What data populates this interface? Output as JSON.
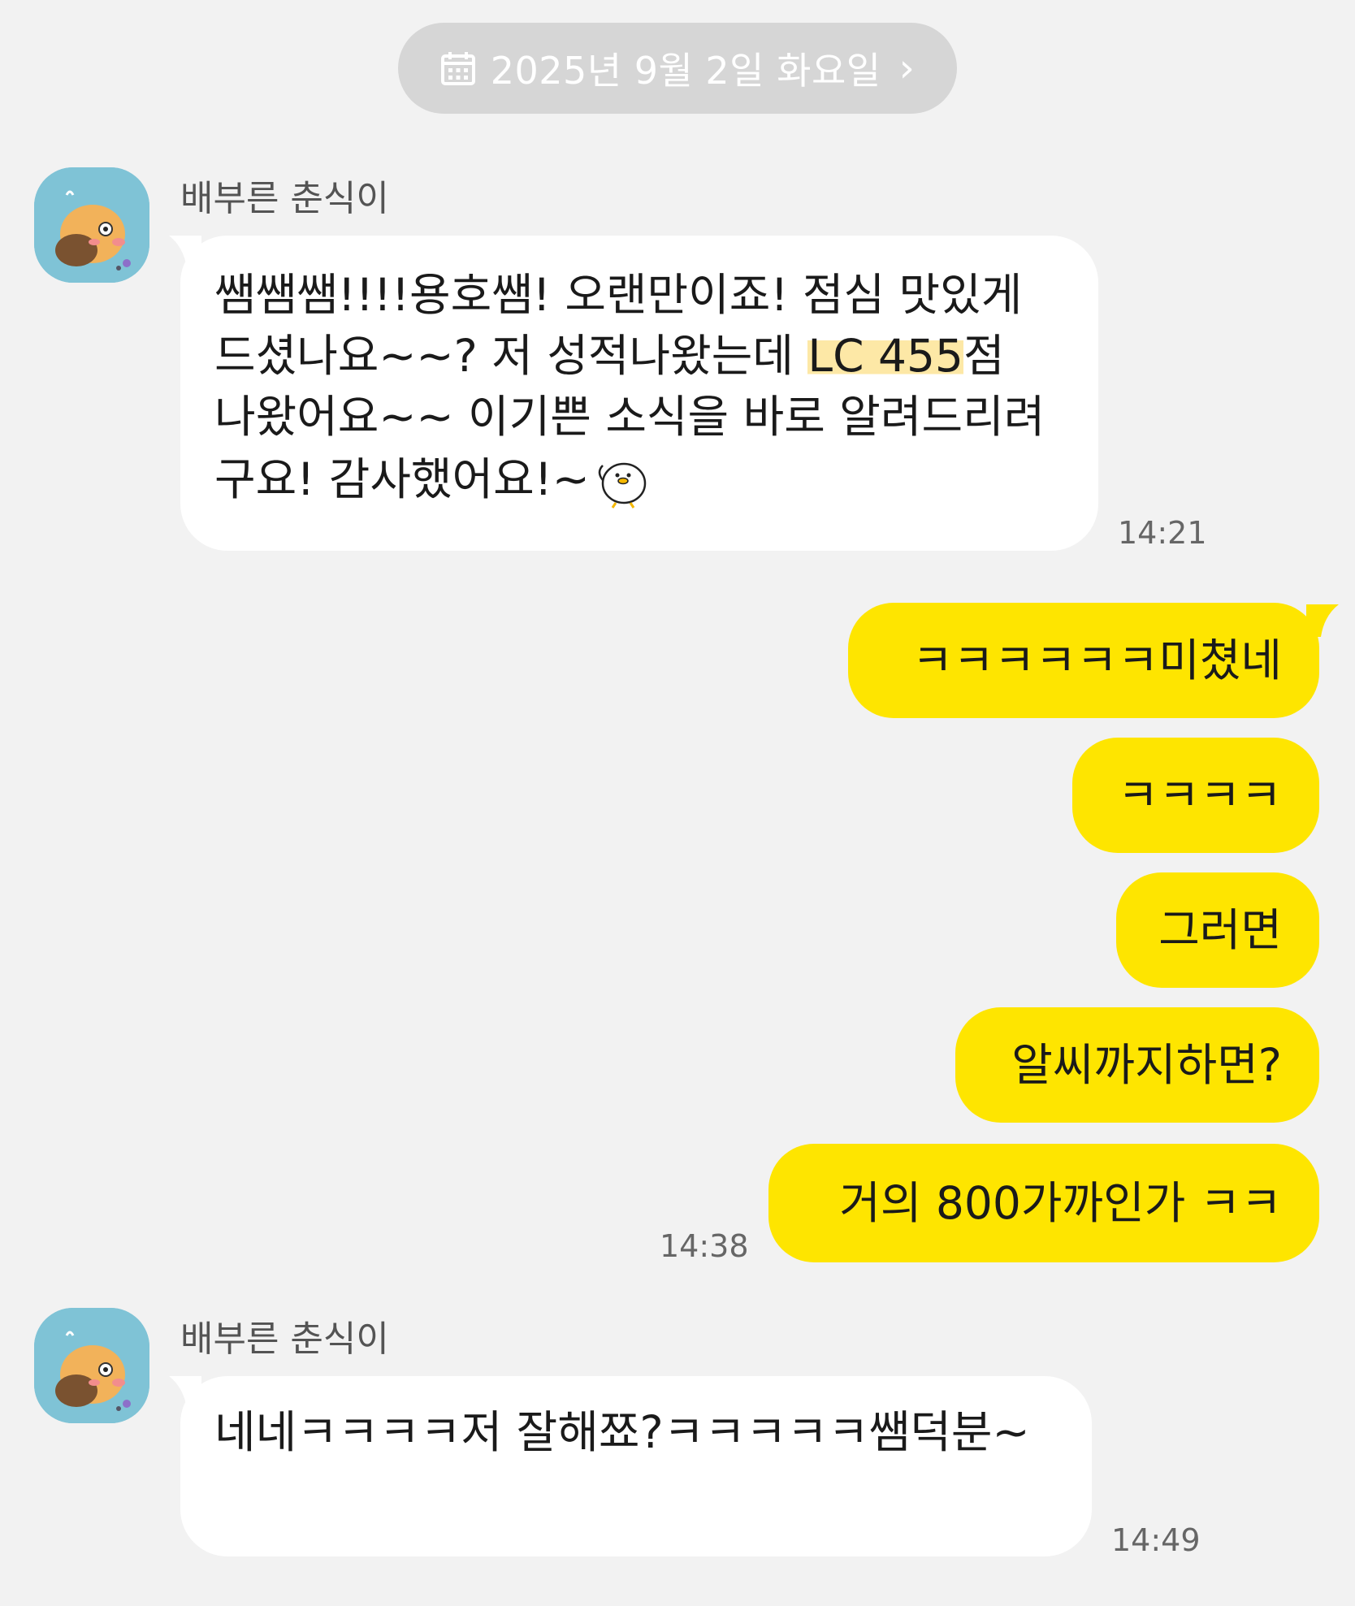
{
  "date_header": {
    "label": "2025년 9월 2일 화요일"
  },
  "messages": [
    {
      "direction": "in",
      "sender": "배부른 춘식이",
      "text_before": "쌤쌤쌤!!!!용호쌤! 오랜만이죠! 점심 맛있게 드셨나요~~? 저 성적나왔는데 ",
      "text_highlight": "LC 455",
      "text_after": "점 나왔어요~~ 이기쁜 소식을 바로 알려드리려구요! 감사했어요!~",
      "emoticon": "duck-emoticon",
      "time": "14:21"
    },
    {
      "direction": "out",
      "text": "ㅋㅋㅋㅋㅋㅋ미쳤네"
    },
    {
      "direction": "out",
      "text": "ㅋㅋㅋㅋ"
    },
    {
      "direction": "out",
      "text": "그러면"
    },
    {
      "direction": "out",
      "text": "알씨까지하면?"
    },
    {
      "direction": "out",
      "text": "거의 800가까인가 ㅋㅋ",
      "time": "14:38"
    },
    {
      "direction": "in",
      "sender": "배부른 춘식이",
      "text": "네네ㅋㅋㅋㅋ저 잘해쬬?ㅋㅋㅋㅋㅋ쌤덕분~",
      "time": "14:49"
    }
  ],
  "colors": {
    "background": "#f2f2f2",
    "incoming_bubble": "#ffffff",
    "outgoing_bubble": "#fee500",
    "date_pill": "#d6d6d6",
    "avatar_bg": "#7fc3d6",
    "highlight": "#fde8a6"
  }
}
